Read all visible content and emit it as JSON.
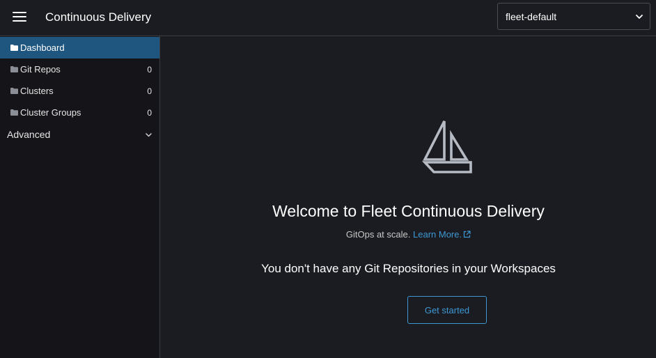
{
  "header": {
    "app_title": "Continuous Delivery",
    "workspace_select": {
      "value": "fleet-default"
    }
  },
  "sidebar": {
    "items": [
      {
        "label": "Dashboard",
        "count": "",
        "active": true,
        "icon": "folder-icon"
      },
      {
        "label": "Git Repos",
        "count": "0",
        "active": false,
        "icon": "folder-icon"
      },
      {
        "label": "Clusters",
        "count": "0",
        "active": false,
        "icon": "folder-icon"
      },
      {
        "label": "Cluster Groups",
        "count": "0",
        "active": false,
        "icon": "folder-icon"
      }
    ],
    "advanced_label": "Advanced"
  },
  "main": {
    "logo_icon": "sailboat-icon",
    "welcome_title": "Welcome to Fleet Continuous Delivery",
    "tagline": "GitOps at scale.",
    "learn_more": "Learn More.",
    "empty_message": "You don't have any Git Repositories in your Workspaces",
    "get_started_label": "Get started"
  },
  "colors": {
    "background": "#1b1c21",
    "sidebar": "#141419",
    "active_item": "#1f5680",
    "link": "#3d98d3",
    "logo": "#b5bac3"
  }
}
